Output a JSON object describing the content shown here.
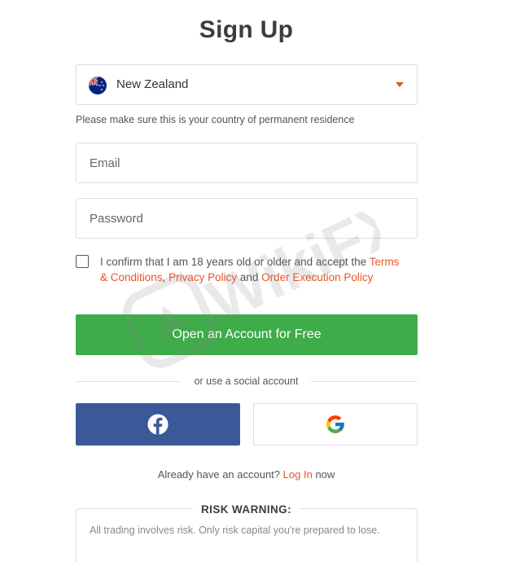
{
  "page": {
    "title": "Sign Up"
  },
  "country": {
    "name": "New Zealand",
    "hint": "Please make sure this is your country of permanent residence"
  },
  "email": {
    "placeholder": "Email"
  },
  "password": {
    "placeholder": "Password"
  },
  "consent": {
    "prefix": "I confirm that I am 18 years old or older and accept the",
    "terms": "Terms & Conditions",
    "sep": ", ",
    "privacy": "Privacy Policy",
    "and": " and ",
    "execution": "Order Execution Policy"
  },
  "cta": {
    "label": "Open an Account for Free"
  },
  "divider": {
    "text": "or use a social account"
  },
  "login": {
    "prefix": "Already have an account?",
    "link": "Log In",
    "suffix": "now"
  },
  "risk": {
    "title": "RISK WARNING:",
    "text": "All trading involves risk. Only risk capital you're prepared to lose."
  },
  "watermark": {
    "text": "WikiFX"
  },
  "colors": {
    "accent": "#e8542a",
    "cta": "#3eac49",
    "facebook": "#3b5998"
  },
  "icons": {
    "country": "new-zealand-flag-icon",
    "dropdown": "caret-down-icon",
    "facebook": "facebook-icon",
    "google": "google-icon"
  }
}
